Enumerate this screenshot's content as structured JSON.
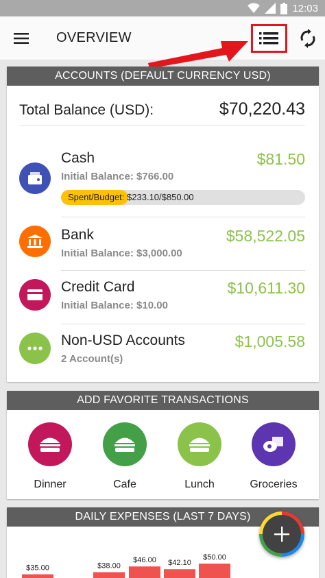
{
  "status_bar": {
    "time": "12:03",
    "icons": [
      "wifi-icon",
      "signal-icon",
      "battery-icon"
    ]
  },
  "app_bar": {
    "title": "OVERVIEW",
    "icons": [
      "menu-icon",
      "list-icon",
      "sync-icon"
    ]
  },
  "accounts": {
    "header": "ACCOUNTS (DEFAULT CURRENCY USD)",
    "total_label": "Total Balance (USD):",
    "total_value": "$70,220.43",
    "items": [
      {
        "name": "Cash",
        "sub": "Initial Balance: $766.00",
        "amount": "$81.50",
        "icon": "wallet-icon",
        "color": "#3f51b5"
      },
      {
        "name": "Bank",
        "sub": "Initial Balance: $3,000.00",
        "amount": "$58,522.05",
        "icon": "bank-icon",
        "color": "#ff6f00"
      },
      {
        "name": "Credit Card",
        "sub": "Initial Balance: $10.00",
        "amount": "$10,611.30",
        "icon": "credit-card-icon",
        "color": "#c2185b"
      },
      {
        "name": "Non-USD Accounts",
        "sub": "2 Account(s)",
        "amount": "$1,005.58",
        "icon": "more-icon",
        "color": "#8bc34a"
      }
    ],
    "budget": {
      "label": "Spent/Budget:",
      "value": "$233.10/$850.00",
      "fraction": 0.274
    }
  },
  "favorites": {
    "header": "ADD FAVORITE TRANSACTIONS",
    "items": [
      {
        "label": "Dinner",
        "icon": "burger-icon",
        "color": "#c2185b"
      },
      {
        "label": "Cafe",
        "icon": "burger-icon",
        "color": "#43a047"
      },
      {
        "label": "Lunch",
        "icon": "burger-icon",
        "color": "#8bc34a"
      },
      {
        "label": "Groceries",
        "icon": "groceries-icon",
        "color": "#5e35b1"
      }
    ]
  },
  "daily_expenses": {
    "header": "DAILY EXPENSES (LAST 7 DAYS)"
  },
  "chart_data": {
    "type": "bar",
    "title": "DAILY EXPENSES (LAST 7 DAYS)",
    "values": [
      35.0,
      0,
      38.0,
      46.0,
      42.1,
      50.0
    ],
    "labels": [
      "$35.00",
      "",
      "$38.00",
      "$46.00",
      "$42.10",
      "$50.00"
    ],
    "bar_color": "#ef5350"
  },
  "fab": {
    "icon": "plus-icon"
  },
  "colors": {
    "accent": "#8bc34a",
    "header": "#5e5e5e",
    "highlight": "#e4161d"
  }
}
